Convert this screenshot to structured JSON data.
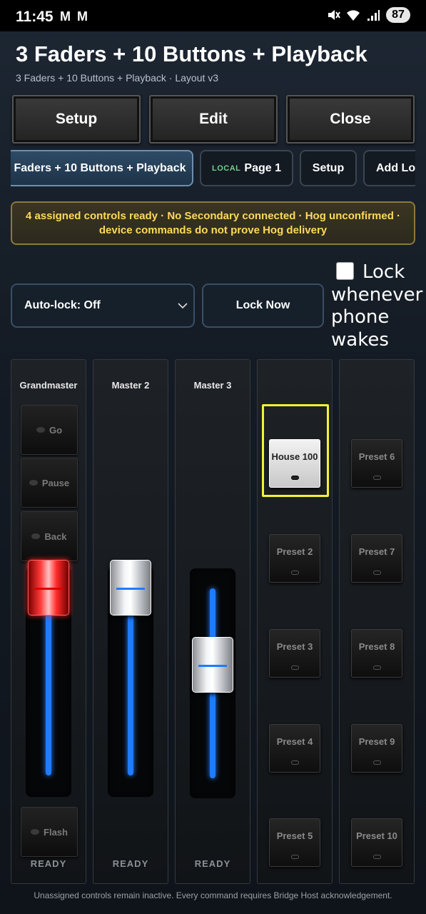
{
  "status_bar": {
    "time": "11:45",
    "notifications": "M M",
    "battery": "87"
  },
  "header": {
    "title": "3 Faders + 10 Buttons + Playback",
    "subtitle": "3 Faders + 10 Buttons + Playback · Layout v3"
  },
  "toolbar": {
    "setup_label": "Setup",
    "edit_label": "Edit",
    "close_label": "Close"
  },
  "tabs": [
    {
      "label": "Faders + 10 Buttons + Playback",
      "active": true
    },
    {
      "prefix": "LOCAL",
      "label": "Page 1"
    },
    {
      "label": "Setup"
    },
    {
      "label": "Add Loc"
    }
  ],
  "banner": {
    "text": "4 assigned controls ready · No Secondary connected · Hog unconfirmed · device commands do not prove Hog delivery"
  },
  "lock": {
    "autolock_value": "Auto-lock: Off",
    "lock_now_label": "Lock Now",
    "wake_checkbox_checked": false,
    "wake_label_line1": "Lock",
    "wake_label_line2": "whenever",
    "wake_label_line3": "phone",
    "wake_label_line4": "wakes"
  },
  "faders": [
    {
      "label": "Grandmaster",
      "status": "READY",
      "level": 0.82,
      "color": "#ff2a2a",
      "buttons": [
        "Go",
        "Pause",
        "Back"
      ],
      "flash_label": "Flash"
    },
    {
      "label": "Master 2",
      "status": "READY",
      "level": 0.82
    },
    {
      "label": "Master 3",
      "status": "READY",
      "level": 0.55
    }
  ],
  "presets": {
    "column1": [
      "House 100",
      "Preset 2",
      "Preset 3",
      "Preset 4",
      "Preset 5"
    ],
    "column2": [
      "Preset 6",
      "Preset 7",
      "Preset 8",
      "Preset 9",
      "Preset 10"
    ],
    "active": "House 100"
  },
  "colors": {
    "accent": "#1f7bff",
    "warning": "#ffd95a",
    "selection": "#f4f135"
  },
  "footer": {
    "text": "Unassigned controls remain inactive. Every command requires Bridge Host acknowledgement."
  }
}
